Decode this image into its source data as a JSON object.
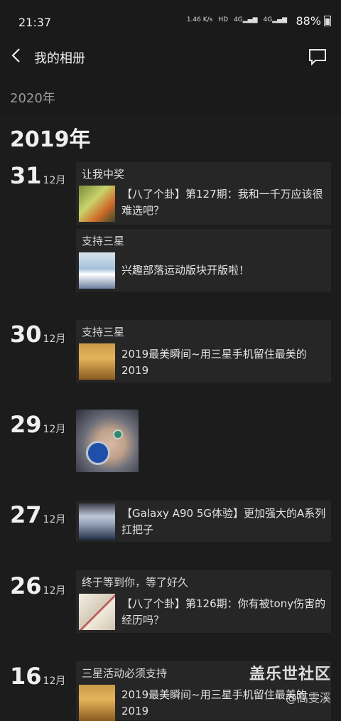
{
  "status": {
    "time": "21:37",
    "speed": "1.46 K/s",
    "hd": "HD",
    "net1": "4G",
    "net2": "4G",
    "battery": "88%"
  },
  "header": {
    "title": "我的相册"
  },
  "years": {
    "y2020": "2020年",
    "y2019": "2019年"
  },
  "entries": [
    {
      "day": "31",
      "month": "12月",
      "cards": [
        {
          "caption": "让我中奖",
          "post": "【八了个卦】第127期：我和一千万应该很难选吧？"
        },
        {
          "caption": "支持三星",
          "post": "兴趣部落运动版块开版啦！"
        }
      ]
    },
    {
      "day": "30",
      "month": "12月",
      "cards": [
        {
          "caption": "支持三星",
          "post": "2019最美瞬间~用三星手机留住最美的2019"
        }
      ]
    },
    {
      "day": "29",
      "month": "12月"
    },
    {
      "day": "27",
      "month": "12月",
      "cards": [
        {
          "caption": "",
          "post": "【Galaxy A90 5G体验】更加强大的A系列扛把子"
        }
      ]
    },
    {
      "day": "26",
      "month": "12月",
      "cards": [
        {
          "caption": "终于等到你，等了好久",
          "post": "【八了个卦】第126期：你有被tony伤害的经历吗？"
        }
      ]
    },
    {
      "day": "16",
      "month": "12月",
      "cards": [
        {
          "caption": "三星活动必须支持",
          "post": "2019最美瞬间~用三星手机留住最美的2019"
        }
      ]
    }
  ],
  "watermark": {
    "line1": "盖乐世社区",
    "line2": "@高雯溪"
  }
}
